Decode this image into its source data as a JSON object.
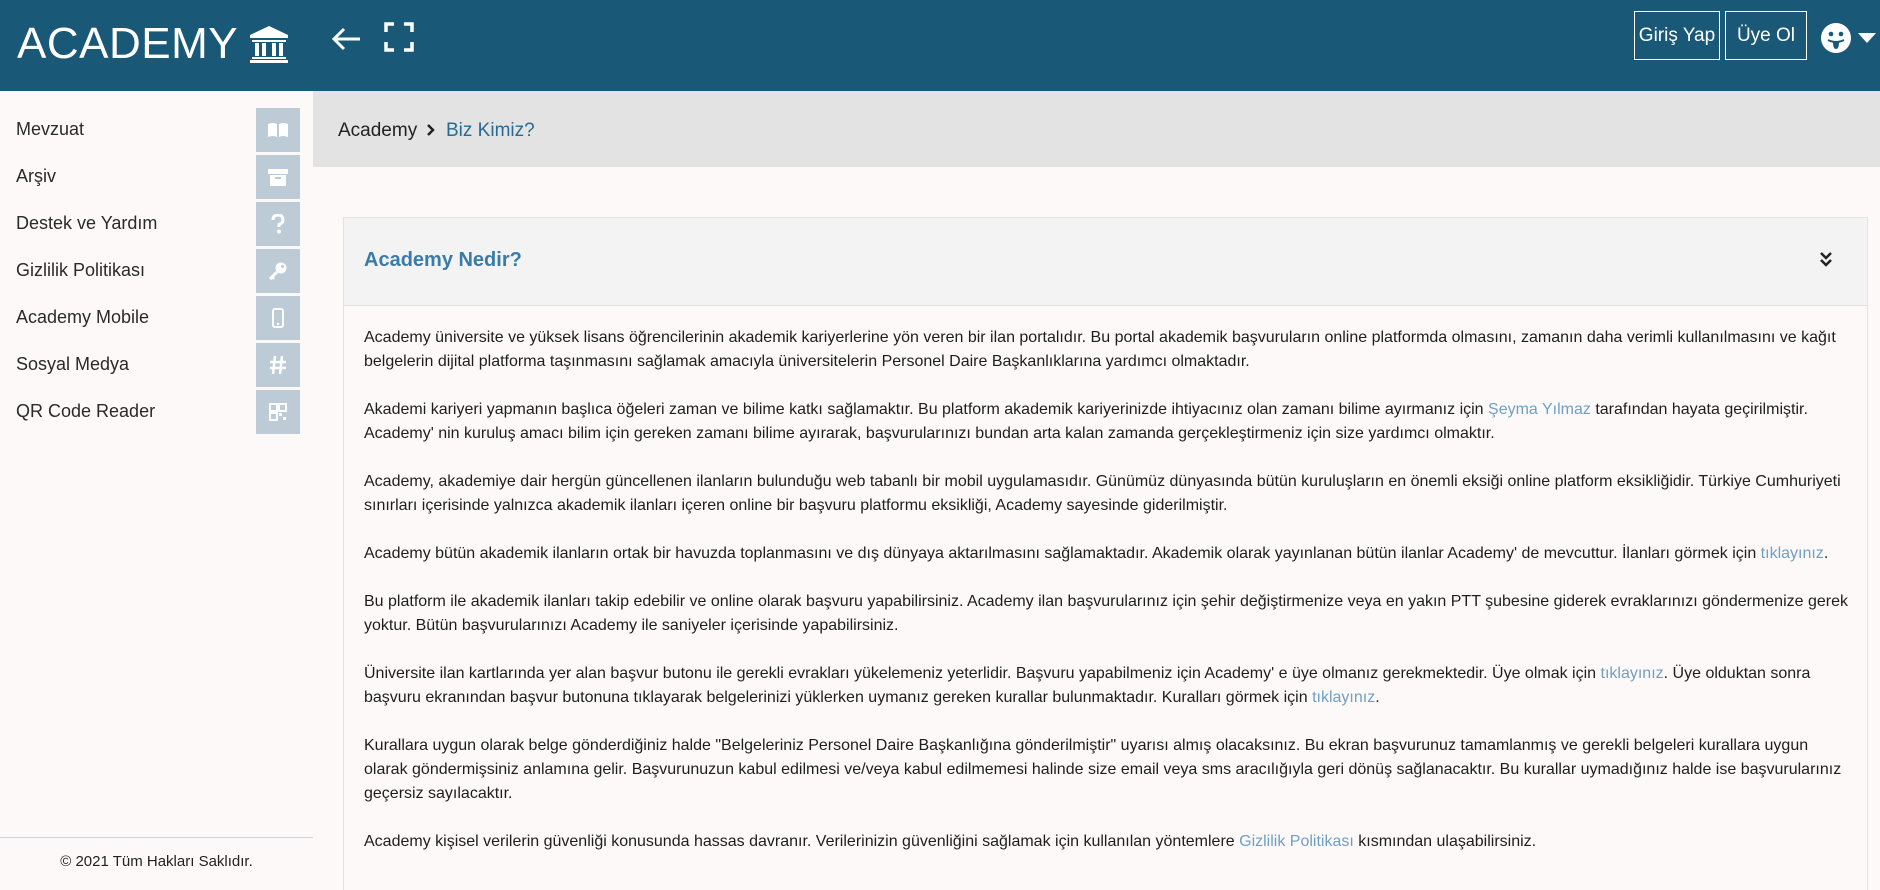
{
  "header": {
    "logo_text": "ACADEMY",
    "login_label": "Giriş Yap",
    "signup_label": "Üye Ol",
    "brand_color": "#1a5877"
  },
  "sidebar": {
    "items": [
      {
        "label": "Mevzuat",
        "icon": "book-open-icon"
      },
      {
        "label": "Arşiv",
        "icon": "archive-icon"
      },
      {
        "label": "Destek ve Yardım",
        "icon": "question-icon"
      },
      {
        "label": "Gizlilik Politikası",
        "icon": "key-icon"
      },
      {
        "label": "Academy Mobile",
        "icon": "mobile-icon"
      },
      {
        "label": "Sosyal Medya",
        "icon": "hashtag-icon"
      },
      {
        "label": "QR Code Reader",
        "icon": "qrcode-icon"
      }
    ],
    "footer": "© 2021 Tüm Hakları Saklıdır."
  },
  "breadcrumb": {
    "home": "Academy",
    "current": "Biz Kimiz?"
  },
  "card": {
    "title": "Academy Nedir?",
    "p1": "Academy üniversite ve yüksek lisans öğrencilerinin akademik kariyerlerine yön veren bir ilan portalıdır. Bu portal akademik başvuruların online platformda olmasını, zamanın daha verimli kullanılmasını ve kağıt belgelerin dijital platforma taşınmasını sağlamak amacıyla üniversitelerin Personel Daire Başkanlıklarına yardımcı olmaktadır.",
    "p2_a": "Akademi kariyeri yapmanın başlıca öğeleri zaman ve bilime katkı sağlamaktır. Bu platform akademik kariyerinizde ihtiyacınız olan zamanı bilime ayırmanız için ",
    "p2_link": "Şeyma Yılmaz",
    "p2_b": " tarafından hayata geçirilmiştir. Academy' nin kuruluş amacı bilim için gereken zamanı bilime ayırarak, başvurularınızı bundan arta kalan zamanda gerçekleştirmeniz için size yardımcı olmaktır.",
    "p3": "Academy, akademiye dair hergün güncellenen ilanların bulunduğu web tabanlı bir mobil uygulamasıdır. Günümüz dünyasında bütün kuruluşların en önemli eksiği online platform eksikliğidir. Türkiye Cumhuriyeti sınırları içerisinde yalnızca akademik ilanları içeren online bir başvuru platformu eksikliği, Academy sayesinde giderilmiştir.",
    "p4_a": "Academy bütün akademik ilanların ortak bir havuzda toplanmasını ve dış dünyaya aktarılmasını sağlamaktadır. Akademik olarak yayınlanan bütün ilanlar Academy' de mevcuttur. İlanları görmek için ",
    "p4_link": "tıklayınız",
    "p4_b": ".",
    "p5": "Bu platform ile akademik ilanları takip edebilir ve online olarak başvuru yapabilirsiniz. Academy ilan başvurularınız için şehir değiştirmenize veya en yakın PTT şubesine giderek evraklarınızı göndermenize gerek yoktur. Bütün başvurularınızı Academy ile saniyeler içerisinde yapabilirsiniz.",
    "p6_a": "Üniversite ilan kartlarında yer alan başvur butonu ile gerekli evrakları yükelemeniz yeterlidir. Başvuru yapabilmeniz için Academy' e üye olmanız gerekmektedir. Üye olmak için ",
    "p6_link1": "tıklayınız",
    "p6_b": ". Üye olduktan sonra başvuru ekranından başvur butonuna tıklayarak belgelerinizi yüklerken uymanız gereken kurallar bulunmaktadır. Kuralları görmek için ",
    "p6_link2": "tıklayınız",
    "p6_c": ".",
    "p7": "Kurallara uygun olarak belge gönderdiğiniz halde \"Belgeleriniz Personel Daire Başkanlığına gönderilmiştir\" uyarısı almış olacaksınız. Bu ekran başvurunuz tamamlanmış ve gerekli belgeleri kurallara uygun olarak göndermişsiniz anlamına gelir. Başvurunuzun kabul edilmesi ve/veya kabul edilmemesi halinde size email veya sms aracılığıyla geri dönüş sağlanacaktır. Bu kurallar uymadığınız halde ise başvurularınız geçersiz sayılacaktır.",
    "p8_a": "Academy kişisel verilerin güvenliği konusunda hassas davranır. Verilerinizin güvenliğini sağlamak için kullanılan yöntemlere ",
    "p8_link": "Gizlilik Politikası",
    "p8_b": " kısmından ulaşabilirsiniz."
  }
}
